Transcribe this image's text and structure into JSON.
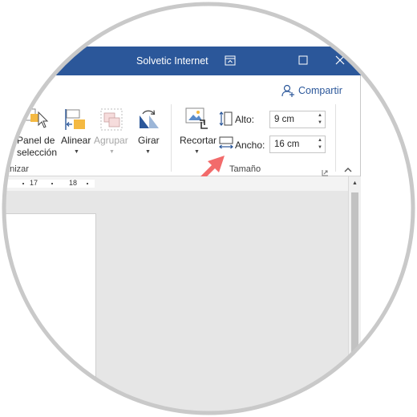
{
  "window": {
    "title": "Solvetic Internet",
    "share_label": "Compartir"
  },
  "ribbon": {
    "organize": {
      "selection_pane_line1": "Panel de",
      "selection_pane_line2": "selección",
      "align_label": "Alinear",
      "group_label": "Agrupar",
      "rotate_label": "Girar",
      "group_name": "anizar"
    },
    "size": {
      "crop_label": "Recortar",
      "height_label": "Alto:",
      "height_value": "9 cm",
      "width_label": "Ancho:",
      "width_value": "16 cm",
      "group_name": "Tamaño"
    }
  },
  "ruler": {
    "numbers": [
      "17",
      "18"
    ]
  },
  "icons": {
    "title_bar": [
      "ribbon-display-icon",
      "maximize-icon",
      "close-icon"
    ],
    "share": "person-add-icon",
    "ribbon": [
      "selection-pane-icon",
      "align-icon",
      "group-icon",
      "rotate-icon",
      "crop-icon",
      "shape-height-icon",
      "shape-width-icon",
      "dialog-launcher-icon",
      "collapse-ribbon-icon"
    ],
    "annotation": "red-arrow-icon"
  },
  "colors": {
    "title_bar": "#2b579a",
    "accent_text": "#2b579a",
    "annotation_arrow": "#f26b6b",
    "document_background": "#e6e6e6",
    "vignette_border": "#c9c9c9"
  }
}
